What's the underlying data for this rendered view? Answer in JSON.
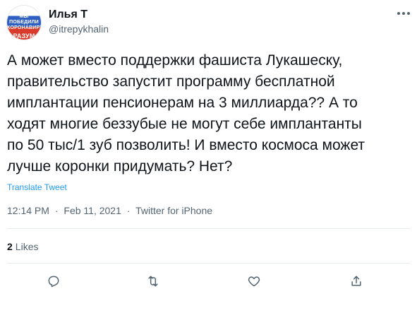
{
  "author": {
    "name": "Илья Т",
    "handle": "@itrepykhalin",
    "avatar_text": [
      "Мы",
      "победили",
      "коронавирус",
      "РАЗУМ"
    ]
  },
  "tweet": {
    "text": "А может вместо поддержки фашиста Лукашеску,\nправительство запустит программу бесплатной\nимплантации пенсионерам на 3 миллиарда?? А то\nходят многие беззубые не могут себе имплантанты\nпо 50 тыс/1 зуб позволить! И вместо космоса может\nлучше коронки придумать? Нет?",
    "translate_label": "Translate Tweet",
    "time": "12:14 PM",
    "separator": "·",
    "date": "Feb 11, 2021",
    "source": "Twitter for iPhone"
  },
  "stats": {
    "likes_count": "2",
    "likes_label": "Likes"
  },
  "icons": {
    "more": "more-options-icon",
    "reply": "reply-icon",
    "retweet": "retweet-icon",
    "like": "like-icon",
    "share": "share-icon"
  },
  "colors": {
    "text": "#0f1419",
    "secondary": "#536471",
    "link": "#1d9bf0",
    "divider": "#e6ecf0"
  }
}
